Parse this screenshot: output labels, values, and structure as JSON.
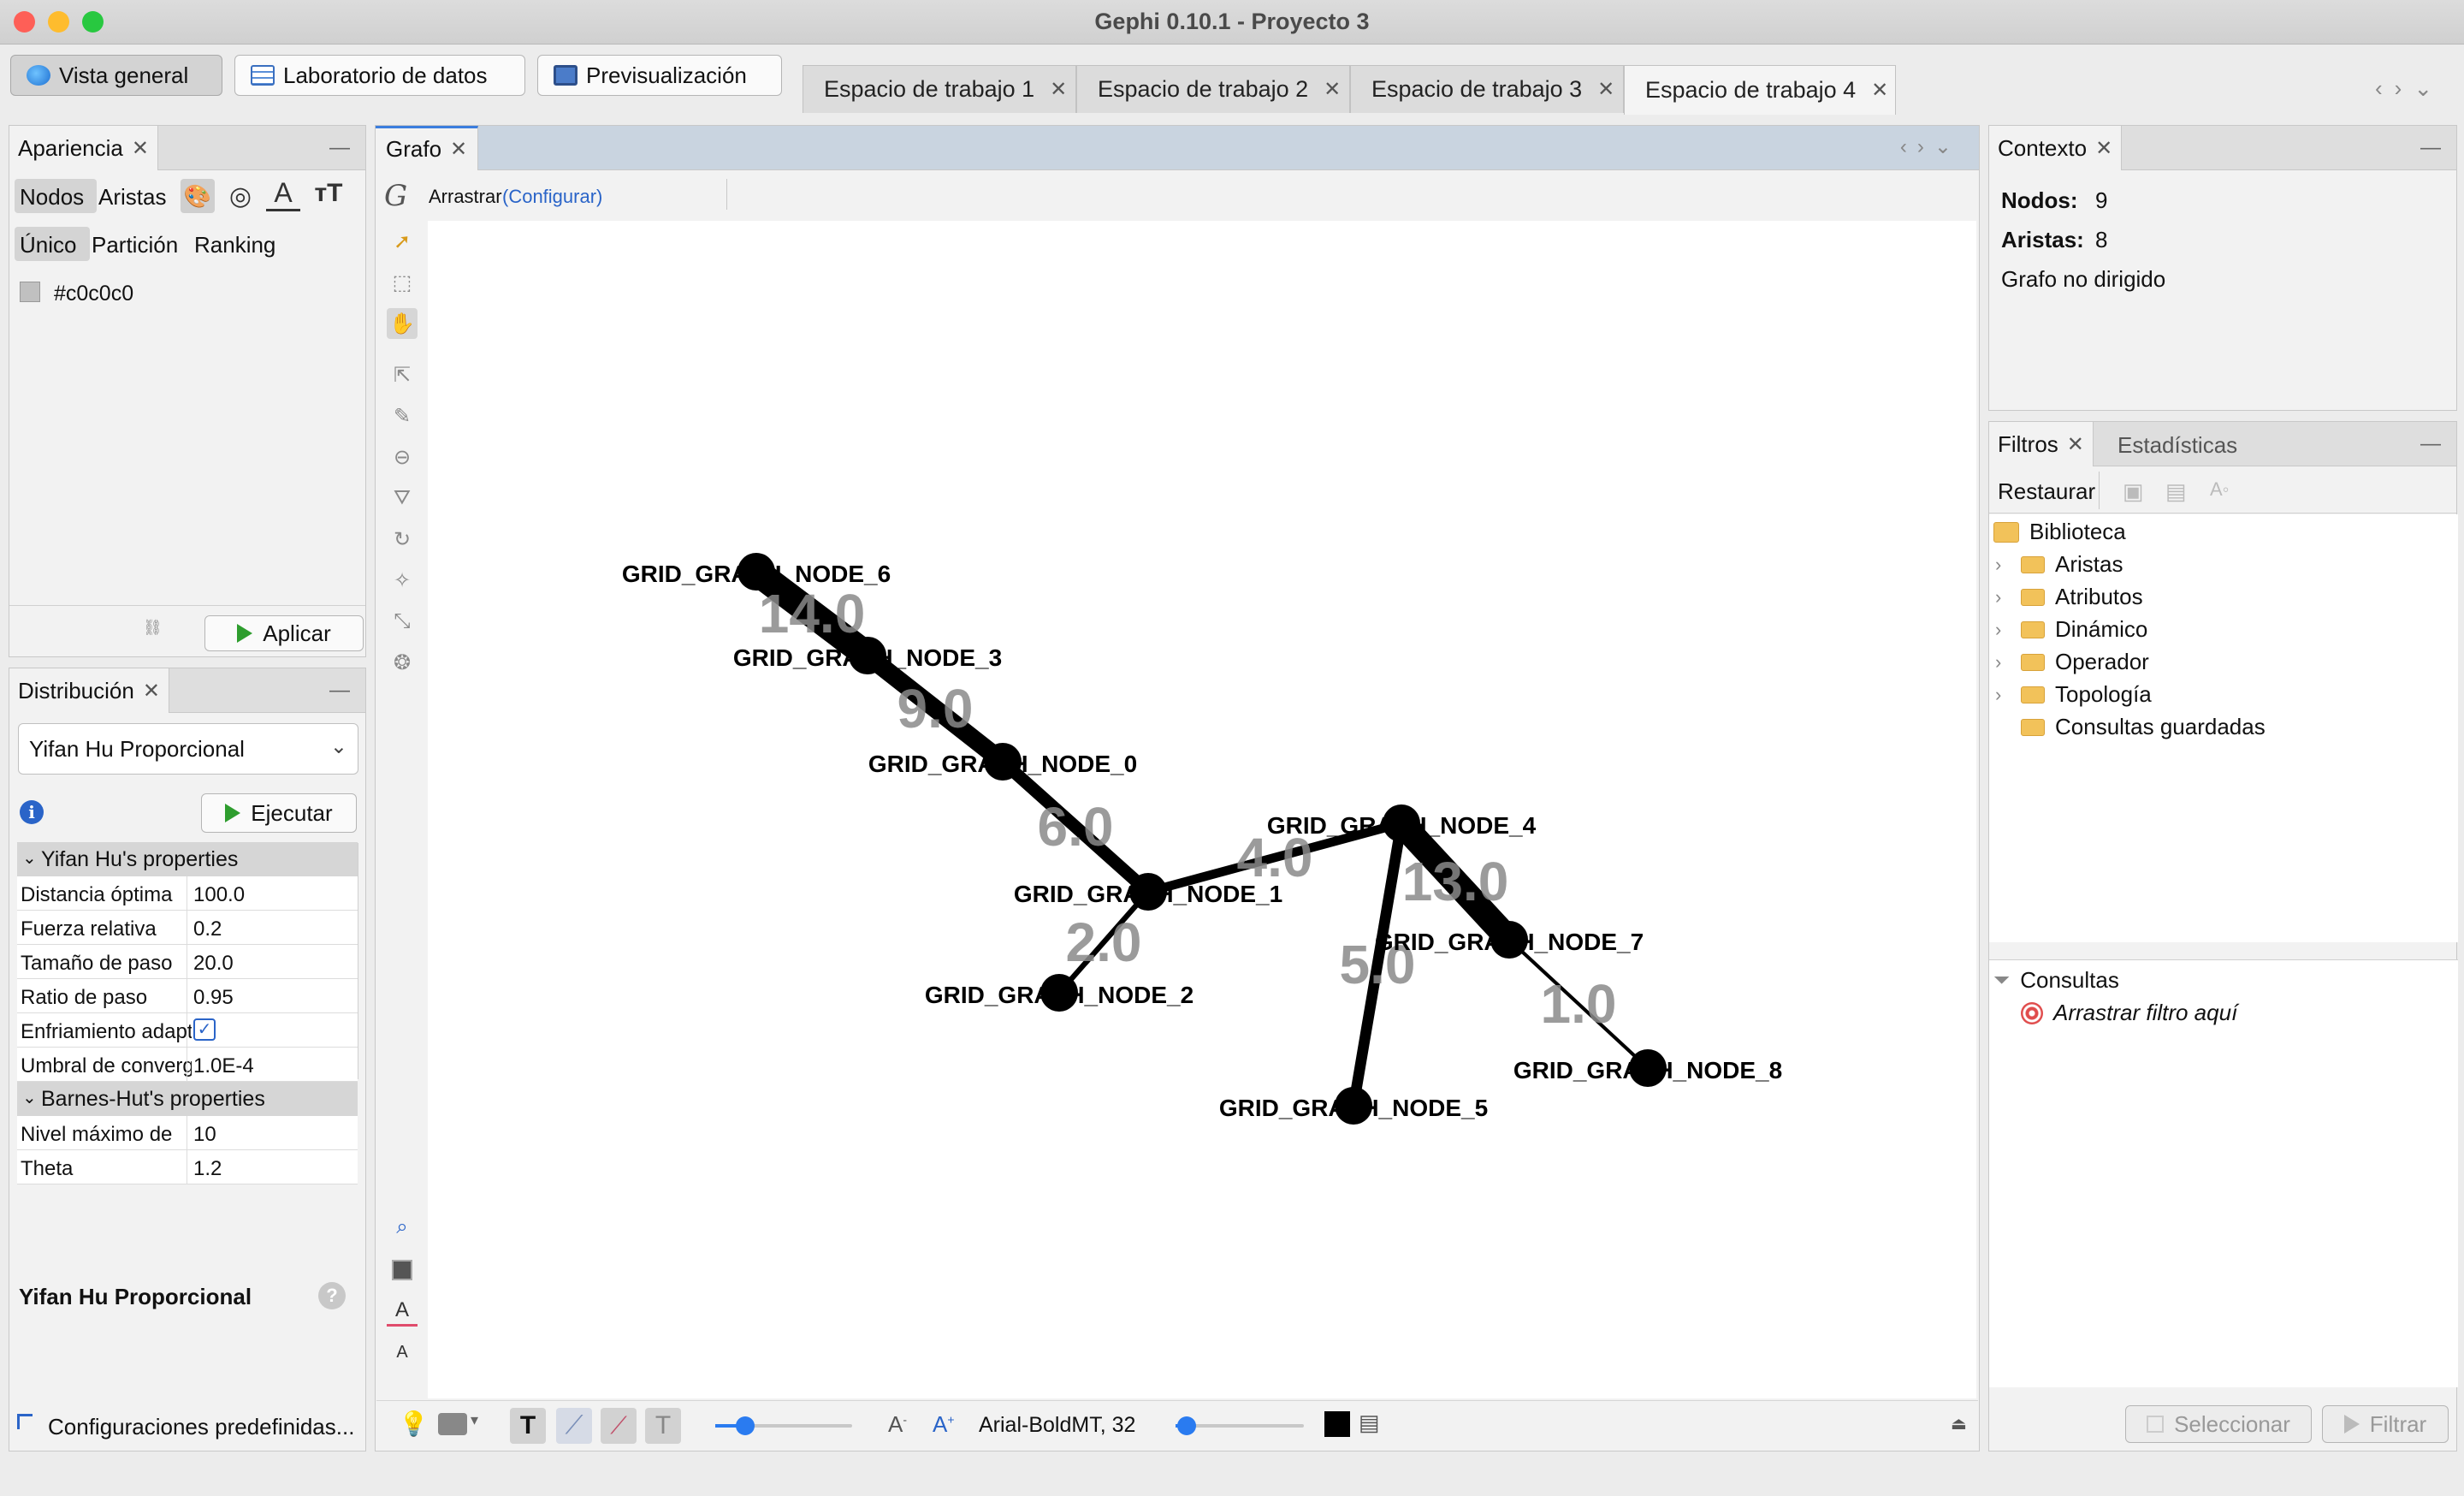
{
  "window": {
    "title": "Gephi 0.10.1 - Proyecto 3"
  },
  "top_buttons": [
    {
      "label": "Vista general",
      "icon": "globe-icon",
      "selected": true
    },
    {
      "label": "Laboratorio de datos",
      "icon": "table-icon",
      "selected": false
    },
    {
      "label": "Previsualización",
      "icon": "monitor-icon",
      "selected": false
    }
  ],
  "workspace_tabs": [
    {
      "label": "Espacio de trabajo 1",
      "selected": false
    },
    {
      "label": "Espacio de trabajo 2",
      "selected": false
    },
    {
      "label": "Espacio de trabajo 3",
      "selected": false
    },
    {
      "label": "Espacio de trabajo 4",
      "selected": true
    }
  ],
  "appearance": {
    "tab": "Apariencia",
    "modes": [
      "Nodos",
      "Aristas"
    ],
    "subtabs": [
      "Único",
      "Partición",
      "Ranking"
    ],
    "color_value": "#c0c0c0",
    "apply": "Aplicar"
  },
  "layout": {
    "tab": "Distribución",
    "algorithm": "Yifan Hu Proporcional",
    "run": "Ejecutar",
    "sections": [
      {
        "title": "Yifan Hu's properties",
        "rows": [
          {
            "key": "Distancia óptima",
            "value": "100.0"
          },
          {
            "key": "Fuerza relativa",
            "value": "0.2"
          },
          {
            "key": "Tamaño de paso",
            "value": "20.0"
          },
          {
            "key": "Ratio de paso",
            "value": "0.95"
          },
          {
            "key": "Enfriamiento adaptativo",
            "value": "",
            "checked": true
          },
          {
            "key": "Umbral de convergencia",
            "value": "1.0E-4"
          }
        ]
      },
      {
        "title": "Barnes-Hut's properties",
        "rows": [
          {
            "key": "Nivel máximo de",
            "value": "10"
          },
          {
            "key": "Theta",
            "value": "1.2"
          }
        ]
      }
    ],
    "description_title": "Yifan Hu Proporcional",
    "presets": "Configuraciones predefinidas..."
  },
  "graph": {
    "tab": "Grafo",
    "tool": "Arrastrar",
    "configure": "(Configurar)",
    "nodes": [
      {
        "id": "GRID_GRAPH_NODE_0"
      },
      {
        "id": "GRID_GRAPH_NODE_1"
      },
      {
        "id": "GRID_GRAPH_NODE_2"
      },
      {
        "id": "GRID_GRAPH_NODE_3"
      },
      {
        "id": "GRID_GRAPH_NODE_4"
      },
      {
        "id": "GRID_GRAPH_NODE_5"
      },
      {
        "id": "GRID_GRAPH_NODE_6"
      },
      {
        "id": "GRID_GRAPH_NODE_7"
      },
      {
        "id": "GRID_GRAPH_NODE_8"
      }
    ],
    "edges": [
      {
        "source": "GRID_GRAPH_NODE_6",
        "target": "GRID_GRAPH_NODE_3",
        "weight": "14.0"
      },
      {
        "source": "GRID_GRAPH_NODE_3",
        "target": "GRID_GRAPH_NODE_0",
        "weight": "9.0"
      },
      {
        "source": "GRID_GRAPH_NODE_0",
        "target": "GRID_GRAPH_NODE_1",
        "weight": "6.0"
      },
      {
        "source": "GRID_GRAPH_NODE_1",
        "target": "GRID_GRAPH_NODE_4",
        "weight": "4.0"
      },
      {
        "source": "GRID_GRAPH_NODE_1",
        "target": "GRID_GRAPH_NODE_2",
        "weight": "2.0"
      },
      {
        "source": "GRID_GRAPH_NODE_4",
        "target": "GRID_GRAPH_NODE_7",
        "weight": "13.0"
      },
      {
        "source": "GRID_GRAPH_NODE_4",
        "target": "GRID_GRAPH_NODE_5",
        "weight": "5.0"
      },
      {
        "source": "GRID_GRAPH_NODE_7",
        "target": "GRID_GRAPH_NODE_8",
        "weight": "1.0"
      }
    ],
    "font_label": "Arial-BoldMT, 32"
  },
  "context": {
    "tab": "Contexto",
    "nodes_label": "Nodos:",
    "nodes_value": "9",
    "edges_label": "Aristas:",
    "edges_value": "8",
    "graph_type": "Grafo no dirigido"
  },
  "filters": {
    "tabs": [
      "Filtros",
      "Estadísticas"
    ],
    "reset": "Restaurar",
    "library": "Biblioteca",
    "categories": [
      "Aristas",
      "Atributos",
      "Dinámico",
      "Operador",
      "Topología",
      "Consultas guardadas"
    ],
    "queries": "Consultas",
    "drop_hint": "Arrastrar filtro aquí",
    "select": "Seleccionar",
    "filter": "Filtrar"
  }
}
